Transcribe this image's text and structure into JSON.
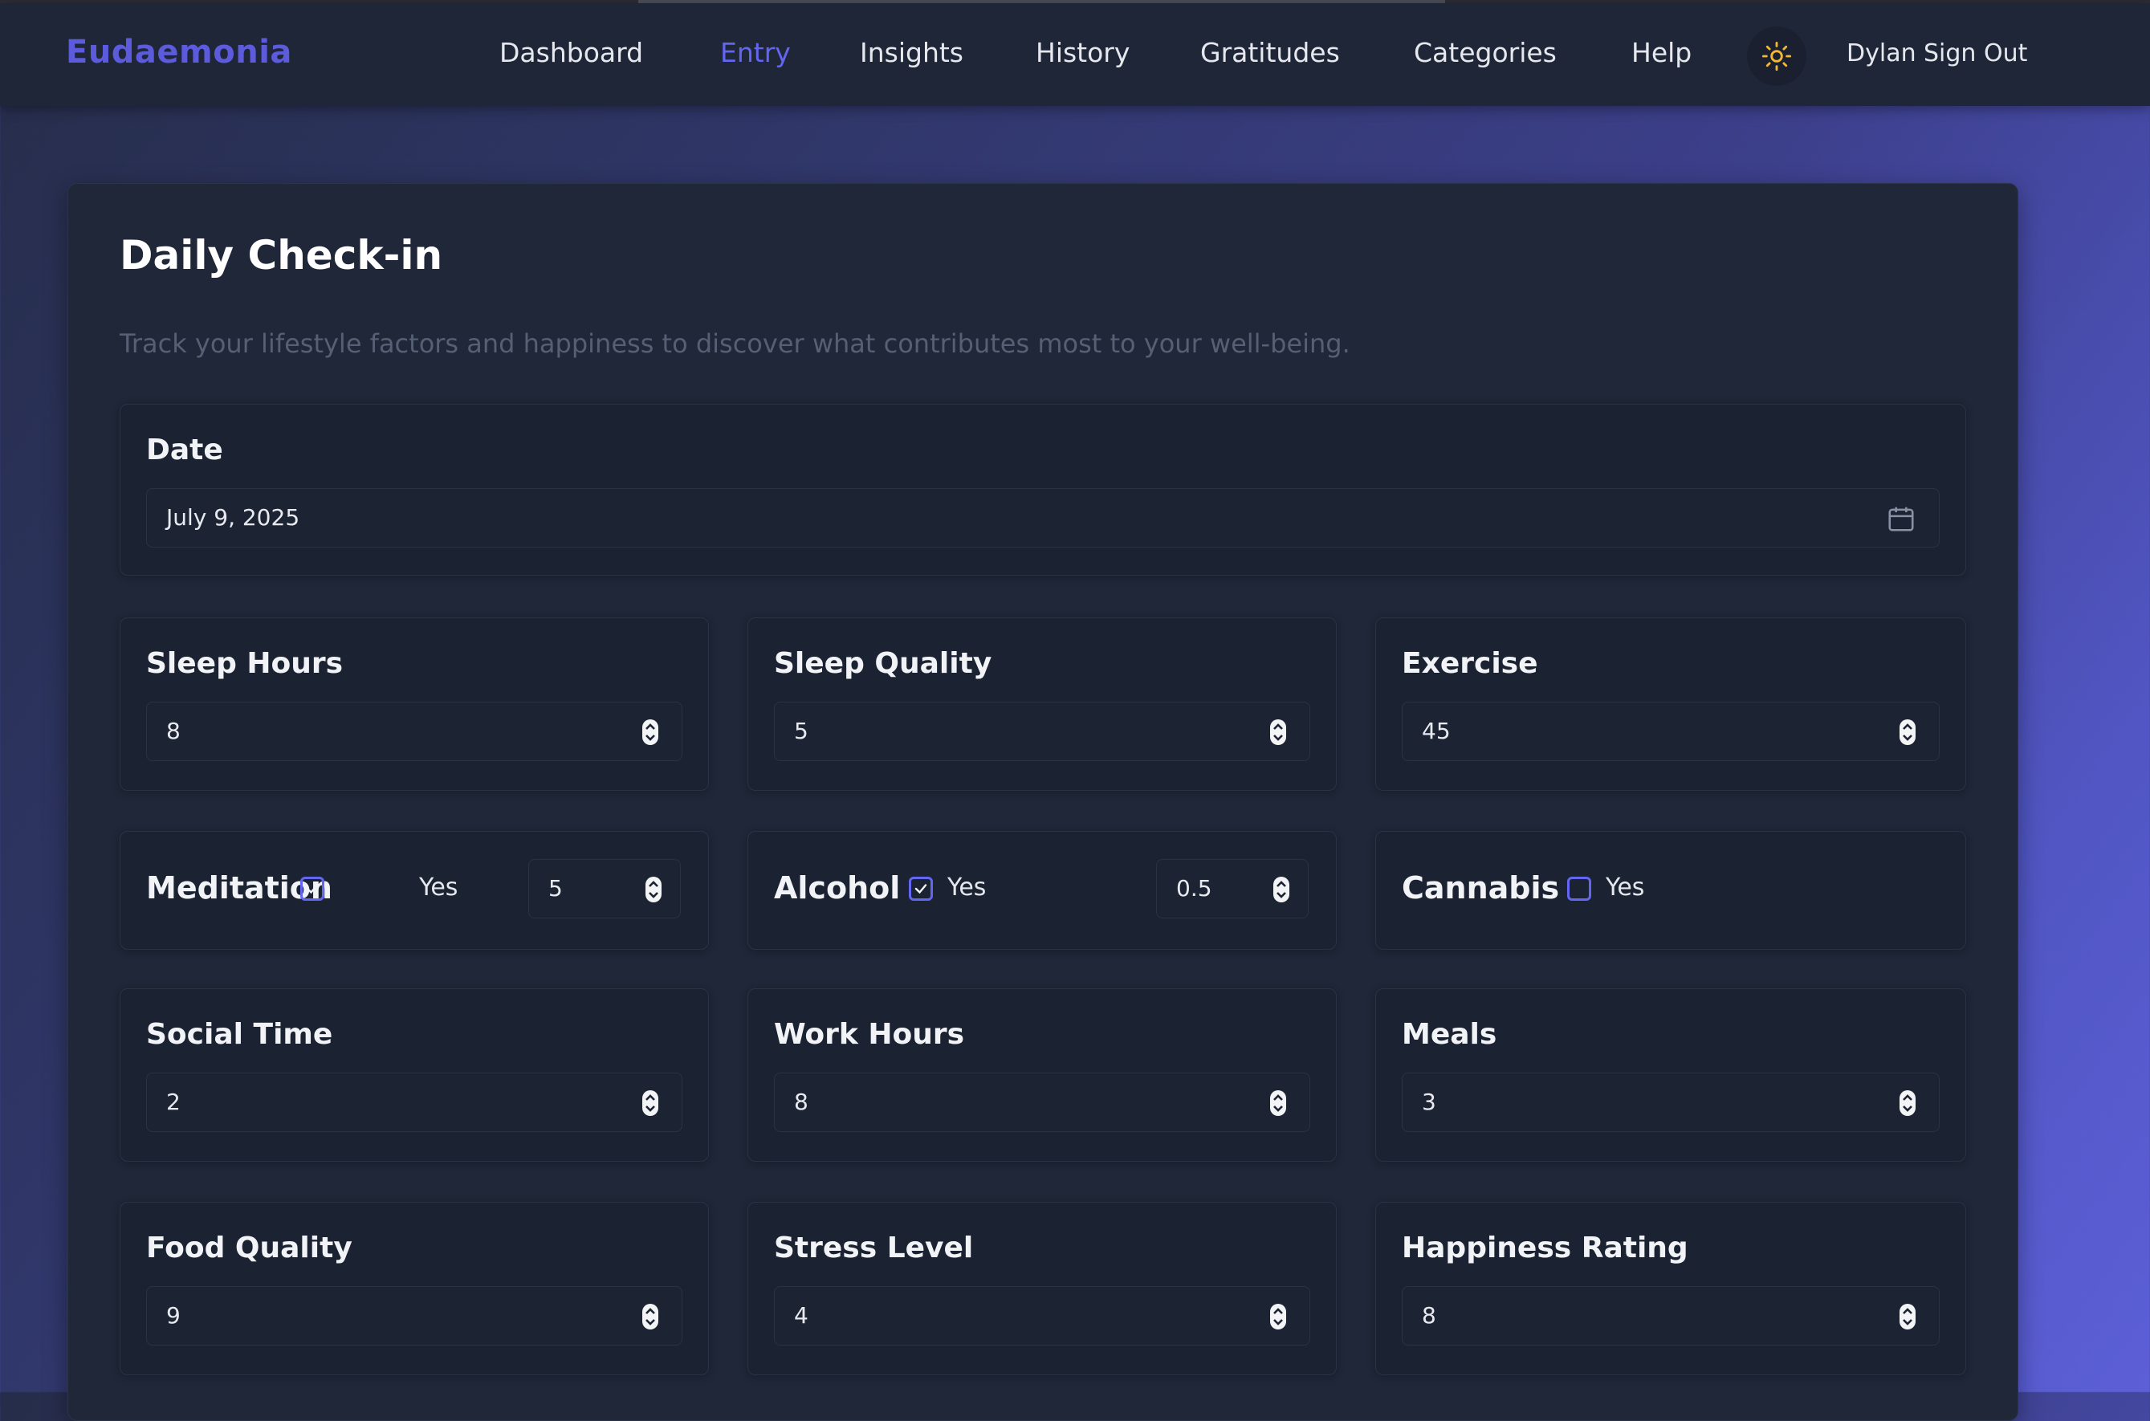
{
  "app": {
    "brand": "Eudaemonia",
    "nav": [
      "Dashboard",
      "Entry",
      "Insights",
      "History",
      "Gratitudes",
      "Categories",
      "Help"
    ],
    "active_nav": "Entry",
    "user": "Dylan",
    "sign_out": "Sign Out",
    "accent": "#6366f1",
    "brand_color": "#5b5bdc"
  },
  "page": {
    "title": "Daily Check-in",
    "subtitle": "Track your lifestyle factors and happiness to discover what contributes most to your well-being."
  },
  "form": {
    "date": {
      "label": "Date",
      "value": "July 9, 2025"
    },
    "sleep_hours": {
      "label": "Sleep Hours",
      "value": "8"
    },
    "sleep_quality": {
      "label": "Sleep Quality",
      "value": "5"
    },
    "exercise": {
      "label": "Exercise",
      "value": "45"
    },
    "meditation": {
      "label": "Meditation",
      "checked": true,
      "yes": "Yes",
      "value": "5"
    },
    "alcohol": {
      "label": "Alcohol",
      "checked": true,
      "yes": "Yes",
      "value": "0.5"
    },
    "cannabis": {
      "label": "Cannabis",
      "checked": false,
      "yes": "Yes"
    },
    "social_time": {
      "label": "Social Time",
      "value": "2"
    },
    "work_hours": {
      "label": "Work Hours",
      "value": "8"
    },
    "meals": {
      "label": "Meals",
      "value": "3"
    },
    "food_quality": {
      "label": "Food Quality",
      "value": "9"
    },
    "stress_level": {
      "label": "Stress Level",
      "value": "4"
    },
    "happiness_rating": {
      "label": "Happiness Rating",
      "value": "8"
    }
  }
}
